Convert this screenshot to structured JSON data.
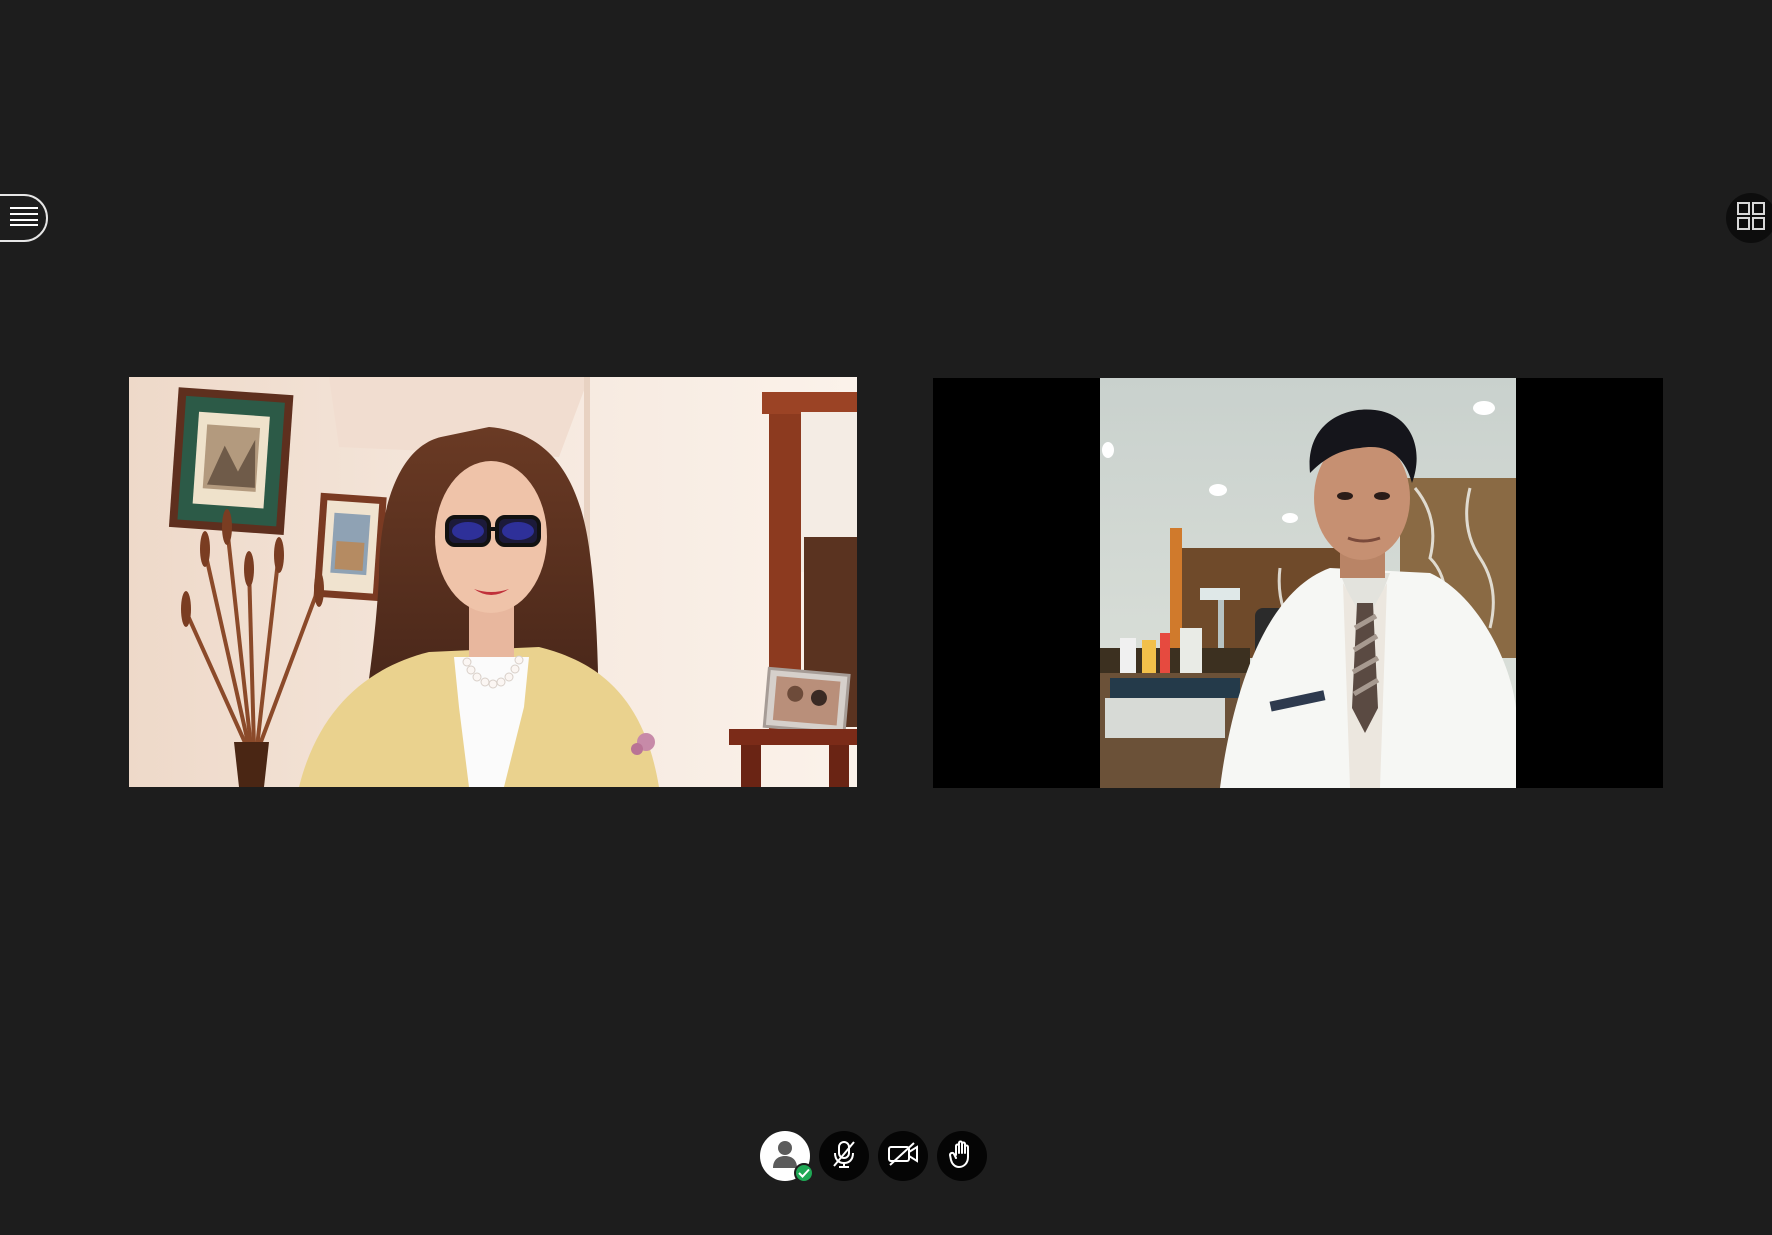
{
  "colors": {
    "background": "#1d1d1d",
    "control_bg": "#050505",
    "status_ok": "#1fa855",
    "icon": "#ffffff"
  },
  "sidebar_toggle": {
    "icon": "hamburger-icon"
  },
  "layout_toggle": {
    "icon": "grid-view-icon"
  },
  "participants": [
    {
      "tile": "video-tile-1",
      "content": "participant-video-1"
    },
    {
      "tile": "video-tile-2",
      "content": "participant-video-2"
    }
  ],
  "controls": [
    {
      "name": "user-status-button",
      "icon": "user-icon",
      "badge": "check-icon"
    },
    {
      "name": "microphone-button",
      "icon": "microphone-muted-icon"
    },
    {
      "name": "camera-button",
      "icon": "camera-off-icon"
    },
    {
      "name": "raise-hand-button",
      "icon": "hand-icon"
    }
  ]
}
